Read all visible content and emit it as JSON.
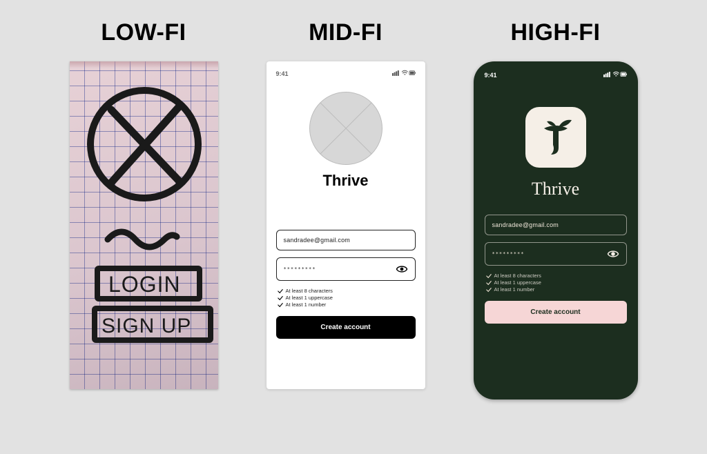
{
  "headings": {
    "low": "LOW-FI",
    "mid": "MID-FI",
    "high": "HIGH-FI"
  },
  "lowfi": {
    "login_label": "LOGIN",
    "signup_label": "SIGN UP"
  },
  "status": {
    "time": "9:41"
  },
  "midfi": {
    "app_name": "Thrive",
    "email_value": "sandradee@gmail.com",
    "password_masked": "*********",
    "requirements": {
      "r1": "At least 8 characters",
      "r2": "At least 1 uppercase",
      "r3": "At least 1 number"
    },
    "cta": "Create account"
  },
  "hifi": {
    "app_name": "Thrive",
    "email_value": "sandradee@gmail.com",
    "password_masked": "*********",
    "requirements": {
      "r1": "At least 8 characters",
      "r2": "At least 1 uppercase",
      "r3": "At least 1 number"
    },
    "cta": "Create account",
    "colors": {
      "bg": "#1c2e1f",
      "accent": "#f6d6d6",
      "cream": "#f5efe7"
    }
  }
}
